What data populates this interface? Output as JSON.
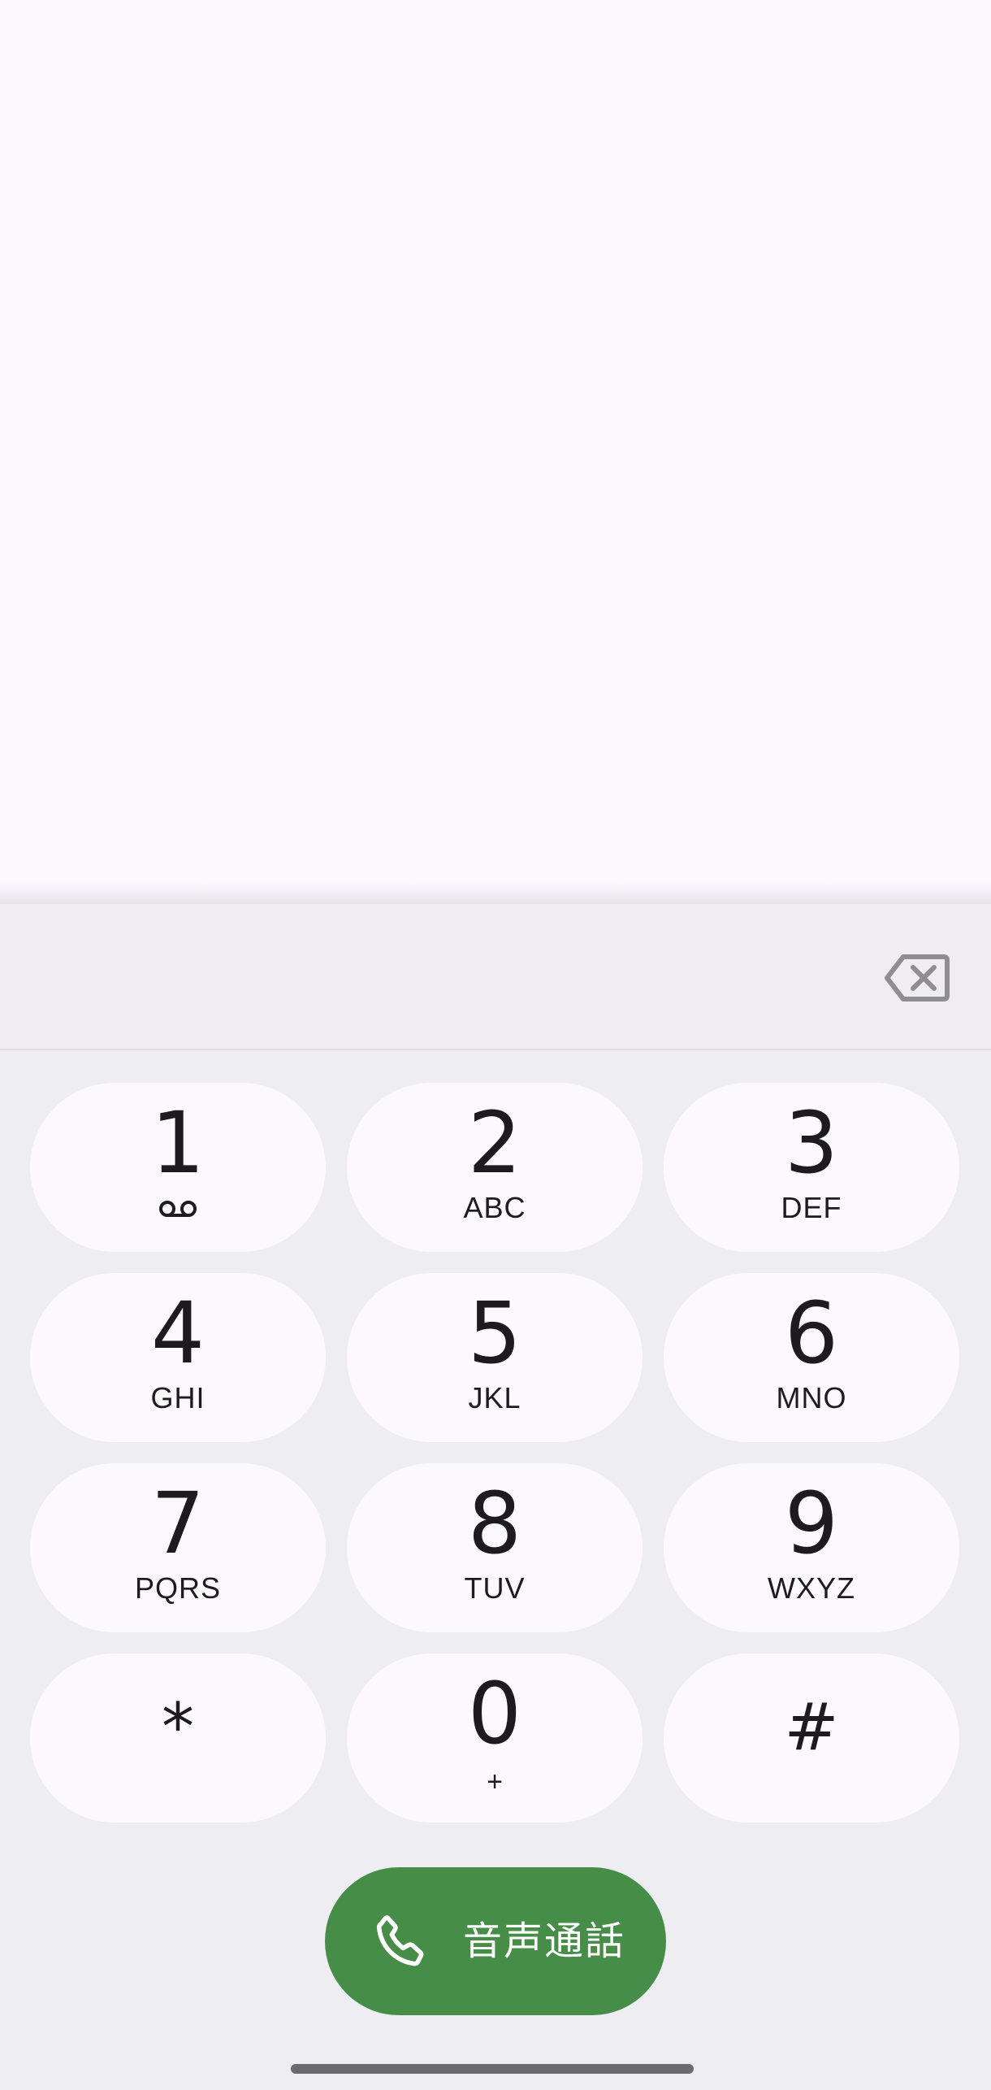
{
  "dialer": {
    "number": "",
    "backspace_icon": "backspace-icon"
  },
  "keys": [
    {
      "digit": "1",
      "letters": "",
      "icon": "voicemail-icon"
    },
    {
      "digit": "2",
      "letters": "ABC"
    },
    {
      "digit": "3",
      "letters": "DEF"
    },
    {
      "digit": "4",
      "letters": "GHI"
    },
    {
      "digit": "5",
      "letters": "JKL"
    },
    {
      "digit": "6",
      "letters": "MNO"
    },
    {
      "digit": "7",
      "letters": "PQRS"
    },
    {
      "digit": "8",
      "letters": "TUV"
    },
    {
      "digit": "9",
      "letters": "WXYZ"
    },
    {
      "digit": "*",
      "letters": ""
    },
    {
      "digit": "0",
      "letters": "+"
    },
    {
      "digit": "#",
      "letters": ""
    }
  ],
  "call_button": {
    "label": "音声通話",
    "icon": "phone-icon"
  },
  "colors": {
    "call_green": "#468d48",
    "key_background": "#fbf9fe",
    "keypad_background": "#eeedf2"
  }
}
